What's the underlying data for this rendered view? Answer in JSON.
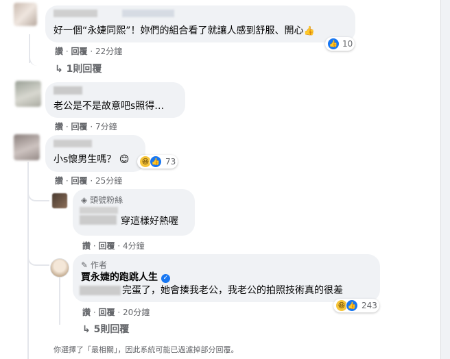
{
  "comments": [
    {
      "text": "好一個“永婕同熙”！妳們的組合看了就讓人感到舒服、開心",
      "reaction_count": "10",
      "actions": {
        "like": "讚",
        "reply": "回覆",
        "time": "22分鐘"
      },
      "replies_toggle": "1則回覆"
    },
    {
      "text": "老公是不是故意吧s照得…",
      "actions": {
        "like": "讚",
        "reply": "回覆",
        "time": "7分鐘"
      }
    },
    {
      "text": "小s懷男生嗎？",
      "reaction_count": "73",
      "actions": {
        "like": "讚",
        "reply": "回覆",
        "time": "25分鐘"
      },
      "replies": [
        {
          "badge": "頭號粉絲",
          "text": "穿這樣好熱喔",
          "actions": {
            "like": "讚",
            "reply": "回覆",
            "time": "4分鐘"
          }
        },
        {
          "badge": "作者",
          "author": "賈永婕的跑跳人生",
          "text": "完蛋了，她會揍我老公，我老公的拍照技術真的很差",
          "reaction_count": "243",
          "actions": {
            "like": "讚",
            "reply": "回覆",
            "time": "20分鐘"
          }
        }
      ],
      "replies_toggle": "5則回覆"
    }
  ],
  "footer_note": "你選擇了「最相關」，因此系統可能已過濾掉部分回覆。",
  "separator": "·",
  "emoji": {
    "thumbs": "👍",
    "smile": "😊",
    "laugh": "😆"
  },
  "colors": {
    "accent": "#1877f2",
    "bubble": "#f0f2f5",
    "meta": "#65676b"
  }
}
